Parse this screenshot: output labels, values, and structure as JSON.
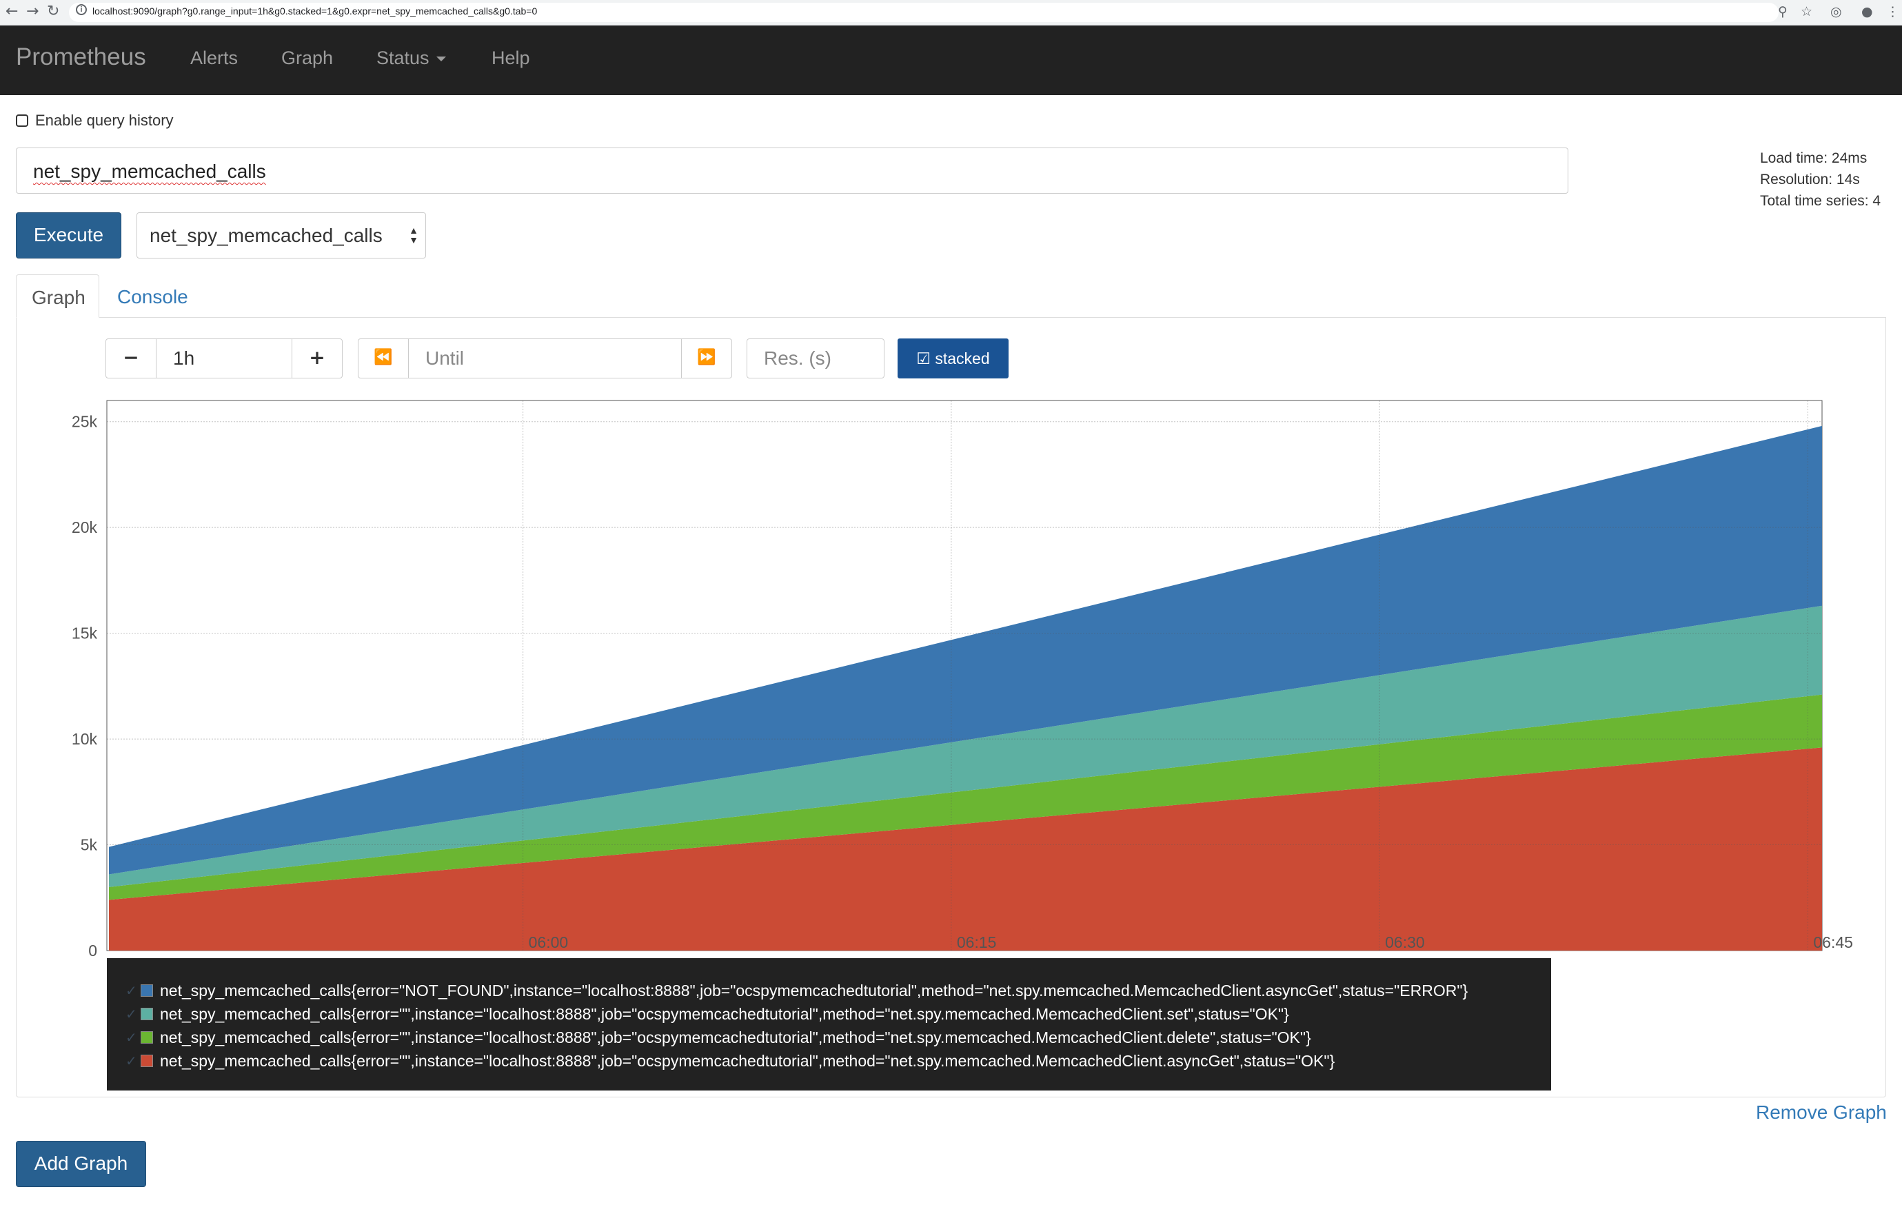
{
  "browser": {
    "url": "localhost:9090/graph?g0.range_input=1h&g0.stacked=1&g0.expr=net_spy_memcached_calls&g0.tab=0"
  },
  "navbar": {
    "brand": "Prometheus",
    "links": [
      "Alerts",
      "Graph",
      "Status",
      "Help"
    ]
  },
  "query": {
    "history_label": "Enable query history",
    "history_checked": false,
    "expression": "net_spy_memcached_calls",
    "execute_label": "Execute",
    "metric_select": "net_spy_memcached_calls"
  },
  "stats": {
    "load_time": "Load time: 24ms",
    "resolution": "Resolution: 14s",
    "total_series": "Total time series: 4"
  },
  "tabs": {
    "graph": "Graph",
    "console": "Console"
  },
  "controls": {
    "minus": "−",
    "range": "1h",
    "plus": "+",
    "back": "⏪",
    "until_placeholder": "Until",
    "forward": "⏩",
    "res_placeholder": "Res. (s)",
    "stacked_label": "stacked",
    "stacked_icon": "check-square-icon"
  },
  "chart_data": {
    "type": "area",
    "stacked": true,
    "x": [
      "05:45",
      "06:45"
    ],
    "x_ticks": [
      "06:00",
      "06:15",
      "06:30",
      "06:45"
    ],
    "y_ticks": [
      "0",
      "5k",
      "10k",
      "15k",
      "20k",
      "25k"
    ],
    "ylim": [
      0,
      26000
    ],
    "grid": true,
    "series": [
      {
        "name": "net_spy_memcached_calls{error=\"\",instance=\"localhost:8888\",job=\"ocspymemcachedtutorial\",method=\"net.spy.memcached.MemcachedClient.asyncGet\",status=\"OK\"}",
        "color": "#cb4b35",
        "values": [
          2400,
          9600
        ]
      },
      {
        "name": "net_spy_memcached_calls{error=\"\",instance=\"localhost:8888\",job=\"ocspymemcachedtutorial\",method=\"net.spy.memcached.MemcachedClient.delete\",status=\"OK\"}",
        "color": "#6bb632",
        "values": [
          600,
          2500
        ]
      },
      {
        "name": "net_spy_memcached_calls{error=\"\",instance=\"localhost:8888\",job=\"ocspymemcachedtutorial\",method=\"net.spy.memcached.MemcachedClient.set\",status=\"OK\"}",
        "color": "#5db0a2",
        "values": [
          600,
          4200
        ]
      },
      {
        "name": "net_spy_memcached_calls{error=\"NOT_FOUND\",instance=\"localhost:8888\",job=\"ocspymemcachedtutorial\",method=\"net.spy.memcached.MemcachedClient.asyncGet\",status=\"ERROR\"}",
        "color": "#3a76b0",
        "values": [
          1300,
          8500
        ]
      }
    ]
  },
  "legend": [
    {
      "label": "net_spy_memcached_calls{error=\"NOT_FOUND\",instance=\"localhost:8888\",job=\"ocspymemcachedtutorial\",method=\"net.spy.memcached.MemcachedClient.asyncGet\",status=\"ERROR\"}",
      "color": "#3a76b0"
    },
    {
      "label": "net_spy_memcached_calls{error=\"\",instance=\"localhost:8888\",job=\"ocspymemcachedtutorial\",method=\"net.spy.memcached.MemcachedClient.set\",status=\"OK\"}",
      "color": "#5db0a2"
    },
    {
      "label": "net_spy_memcached_calls{error=\"\",instance=\"localhost:8888\",job=\"ocspymemcachedtutorial\",method=\"net.spy.memcached.MemcachedClient.delete\",status=\"OK\"}",
      "color": "#6bb632"
    },
    {
      "label": "net_spy_memcached_calls{error=\"\",instance=\"localhost:8888\",job=\"ocspymemcachedtutorial\",method=\"net.spy.memcached.MemcachedClient.asyncGet\",status=\"OK\"}",
      "color": "#cb4b35"
    }
  ],
  "remove_graph": "Remove Graph",
  "add_graph": "Add Graph"
}
